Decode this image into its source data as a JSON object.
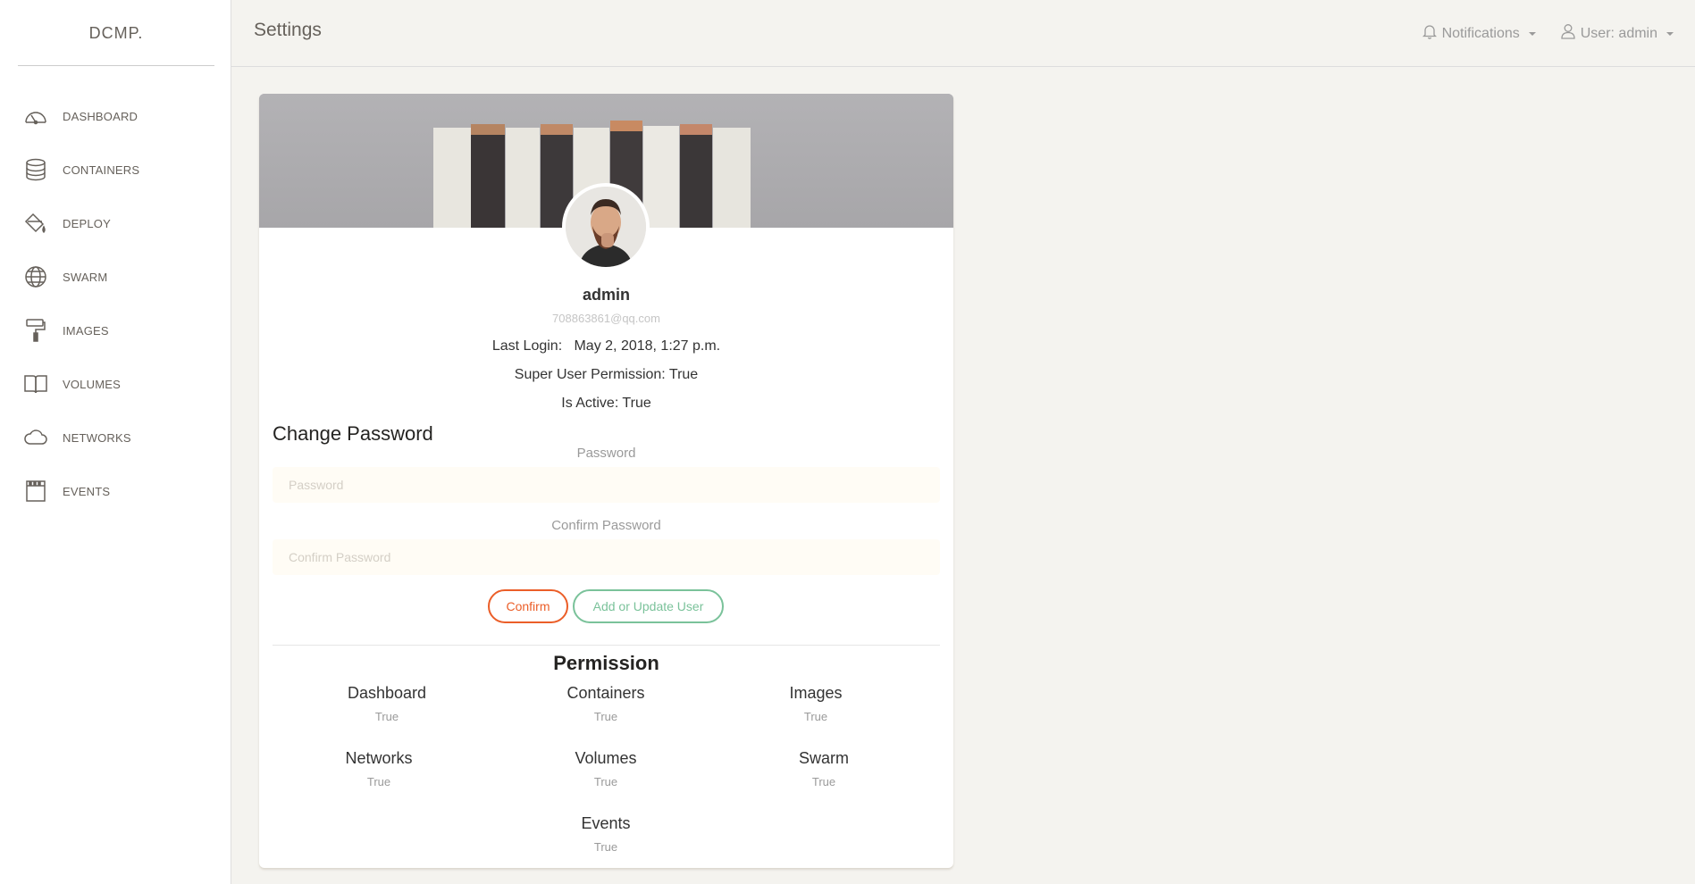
{
  "brand": "DCMP.",
  "page_title": "Settings",
  "top_menu": {
    "notifications": "Notifications",
    "user": "User: admin"
  },
  "sidebar": {
    "items": [
      {
        "label": "DASHBOARD",
        "icon": "dashboard-gauge-icon"
      },
      {
        "label": "CONTAINERS",
        "icon": "database-icon"
      },
      {
        "label": "DEPLOY",
        "icon": "paint-bucket-icon"
      },
      {
        "label": "SWARM",
        "icon": "globe-icon"
      },
      {
        "label": "IMAGES",
        "icon": "paint-roller-icon"
      },
      {
        "label": "VOLUMES",
        "icon": "book-icon"
      },
      {
        "label": "NETWORKS",
        "icon": "cloud-icon"
      },
      {
        "label": "EVENTS",
        "icon": "film-icon"
      }
    ]
  },
  "profile": {
    "username": "admin",
    "email": "708863861@qq.com",
    "last_login": "Last Login:   May 2, 2018, 1:27 p.m.",
    "super_user": "Super User Permission: True",
    "is_active": "Is Active: True"
  },
  "change_password": {
    "heading": "Change Password",
    "password_label": "Password",
    "password_placeholder": "Password",
    "confirm_label": "Confirm Password",
    "confirm_placeholder": "Confirm Password",
    "confirm_button": "Confirm",
    "add_update_button": "Add or Update User"
  },
  "permission": {
    "title": "Permission",
    "items": [
      {
        "name": "Dashboard",
        "value": "True"
      },
      {
        "name": "Containers",
        "value": "True"
      },
      {
        "name": "Images",
        "value": "True"
      },
      {
        "name": "Networks",
        "value": "True"
      },
      {
        "name": "Volumes",
        "value": "True"
      },
      {
        "name": "Swarm",
        "value": "True"
      },
      {
        "name": "Events",
        "value": "True"
      }
    ]
  },
  "colors": {
    "background": "#f4f3ef",
    "primary_orange": "#eb5e28",
    "success_green": "#7ac29a",
    "text_muted": "#9a9a9a"
  }
}
